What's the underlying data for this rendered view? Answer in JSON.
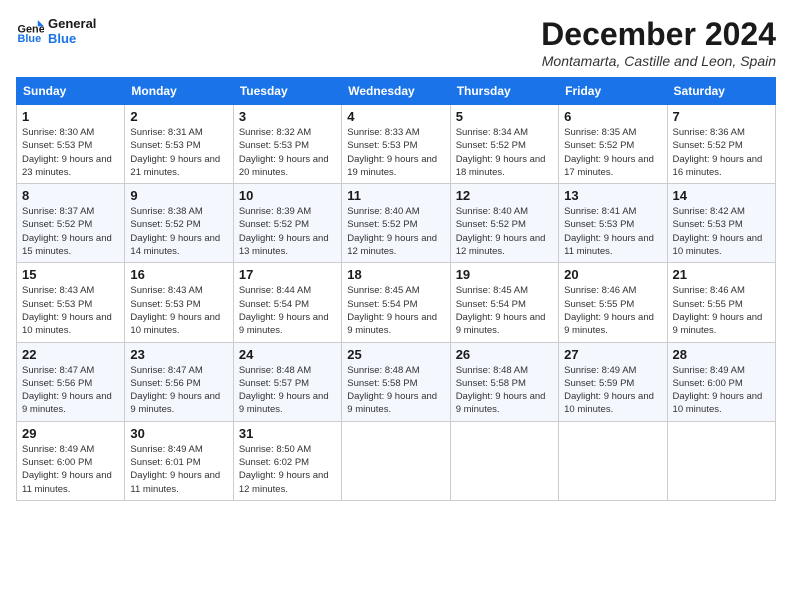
{
  "logo": {
    "line1": "General",
    "line2": "Blue"
  },
  "title": "December 2024",
  "subtitle": "Montamarta, Castille and Leon, Spain",
  "days_header": [
    "Sunday",
    "Monday",
    "Tuesday",
    "Wednesday",
    "Thursday",
    "Friday",
    "Saturday"
  ],
  "weeks": [
    [
      {
        "num": "1",
        "sunrise": "Sunrise: 8:30 AM",
        "sunset": "Sunset: 5:53 PM",
        "daylight": "Daylight: 9 hours and 23 minutes."
      },
      {
        "num": "2",
        "sunrise": "Sunrise: 8:31 AM",
        "sunset": "Sunset: 5:53 PM",
        "daylight": "Daylight: 9 hours and 21 minutes."
      },
      {
        "num": "3",
        "sunrise": "Sunrise: 8:32 AM",
        "sunset": "Sunset: 5:53 PM",
        "daylight": "Daylight: 9 hours and 20 minutes."
      },
      {
        "num": "4",
        "sunrise": "Sunrise: 8:33 AM",
        "sunset": "Sunset: 5:53 PM",
        "daylight": "Daylight: 9 hours and 19 minutes."
      },
      {
        "num": "5",
        "sunrise": "Sunrise: 8:34 AM",
        "sunset": "Sunset: 5:52 PM",
        "daylight": "Daylight: 9 hours and 18 minutes."
      },
      {
        "num": "6",
        "sunrise": "Sunrise: 8:35 AM",
        "sunset": "Sunset: 5:52 PM",
        "daylight": "Daylight: 9 hours and 17 minutes."
      },
      {
        "num": "7",
        "sunrise": "Sunrise: 8:36 AM",
        "sunset": "Sunset: 5:52 PM",
        "daylight": "Daylight: 9 hours and 16 minutes."
      }
    ],
    [
      {
        "num": "8",
        "sunrise": "Sunrise: 8:37 AM",
        "sunset": "Sunset: 5:52 PM",
        "daylight": "Daylight: 9 hours and 15 minutes."
      },
      {
        "num": "9",
        "sunrise": "Sunrise: 8:38 AM",
        "sunset": "Sunset: 5:52 PM",
        "daylight": "Daylight: 9 hours and 14 minutes."
      },
      {
        "num": "10",
        "sunrise": "Sunrise: 8:39 AM",
        "sunset": "Sunset: 5:52 PM",
        "daylight": "Daylight: 9 hours and 13 minutes."
      },
      {
        "num": "11",
        "sunrise": "Sunrise: 8:40 AM",
        "sunset": "Sunset: 5:52 PM",
        "daylight": "Daylight: 9 hours and 12 minutes."
      },
      {
        "num": "12",
        "sunrise": "Sunrise: 8:40 AM",
        "sunset": "Sunset: 5:52 PM",
        "daylight": "Daylight: 9 hours and 12 minutes."
      },
      {
        "num": "13",
        "sunrise": "Sunrise: 8:41 AM",
        "sunset": "Sunset: 5:53 PM",
        "daylight": "Daylight: 9 hours and 11 minutes."
      },
      {
        "num": "14",
        "sunrise": "Sunrise: 8:42 AM",
        "sunset": "Sunset: 5:53 PM",
        "daylight": "Daylight: 9 hours and 10 minutes."
      }
    ],
    [
      {
        "num": "15",
        "sunrise": "Sunrise: 8:43 AM",
        "sunset": "Sunset: 5:53 PM",
        "daylight": "Daylight: 9 hours and 10 minutes."
      },
      {
        "num": "16",
        "sunrise": "Sunrise: 8:43 AM",
        "sunset": "Sunset: 5:53 PM",
        "daylight": "Daylight: 9 hours and 10 minutes."
      },
      {
        "num": "17",
        "sunrise": "Sunrise: 8:44 AM",
        "sunset": "Sunset: 5:54 PM",
        "daylight": "Daylight: 9 hours and 9 minutes."
      },
      {
        "num": "18",
        "sunrise": "Sunrise: 8:45 AM",
        "sunset": "Sunset: 5:54 PM",
        "daylight": "Daylight: 9 hours and 9 minutes."
      },
      {
        "num": "19",
        "sunrise": "Sunrise: 8:45 AM",
        "sunset": "Sunset: 5:54 PM",
        "daylight": "Daylight: 9 hours and 9 minutes."
      },
      {
        "num": "20",
        "sunrise": "Sunrise: 8:46 AM",
        "sunset": "Sunset: 5:55 PM",
        "daylight": "Daylight: 9 hours and 9 minutes."
      },
      {
        "num": "21",
        "sunrise": "Sunrise: 8:46 AM",
        "sunset": "Sunset: 5:55 PM",
        "daylight": "Daylight: 9 hours and 9 minutes."
      }
    ],
    [
      {
        "num": "22",
        "sunrise": "Sunrise: 8:47 AM",
        "sunset": "Sunset: 5:56 PM",
        "daylight": "Daylight: 9 hours and 9 minutes."
      },
      {
        "num": "23",
        "sunrise": "Sunrise: 8:47 AM",
        "sunset": "Sunset: 5:56 PM",
        "daylight": "Daylight: 9 hours and 9 minutes."
      },
      {
        "num": "24",
        "sunrise": "Sunrise: 8:48 AM",
        "sunset": "Sunset: 5:57 PM",
        "daylight": "Daylight: 9 hours and 9 minutes."
      },
      {
        "num": "25",
        "sunrise": "Sunrise: 8:48 AM",
        "sunset": "Sunset: 5:58 PM",
        "daylight": "Daylight: 9 hours and 9 minutes."
      },
      {
        "num": "26",
        "sunrise": "Sunrise: 8:48 AM",
        "sunset": "Sunset: 5:58 PM",
        "daylight": "Daylight: 9 hours and 9 minutes."
      },
      {
        "num": "27",
        "sunrise": "Sunrise: 8:49 AM",
        "sunset": "Sunset: 5:59 PM",
        "daylight": "Daylight: 9 hours and 10 minutes."
      },
      {
        "num": "28",
        "sunrise": "Sunrise: 8:49 AM",
        "sunset": "Sunset: 6:00 PM",
        "daylight": "Daylight: 9 hours and 10 minutes."
      }
    ],
    [
      {
        "num": "29",
        "sunrise": "Sunrise: 8:49 AM",
        "sunset": "Sunset: 6:00 PM",
        "daylight": "Daylight: 9 hours and 11 minutes."
      },
      {
        "num": "30",
        "sunrise": "Sunrise: 8:49 AM",
        "sunset": "Sunset: 6:01 PM",
        "daylight": "Daylight: 9 hours and 11 minutes."
      },
      {
        "num": "31",
        "sunrise": "Sunrise: 8:50 AM",
        "sunset": "Sunset: 6:02 PM",
        "daylight": "Daylight: 9 hours and 12 minutes."
      },
      null,
      null,
      null,
      null
    ]
  ]
}
